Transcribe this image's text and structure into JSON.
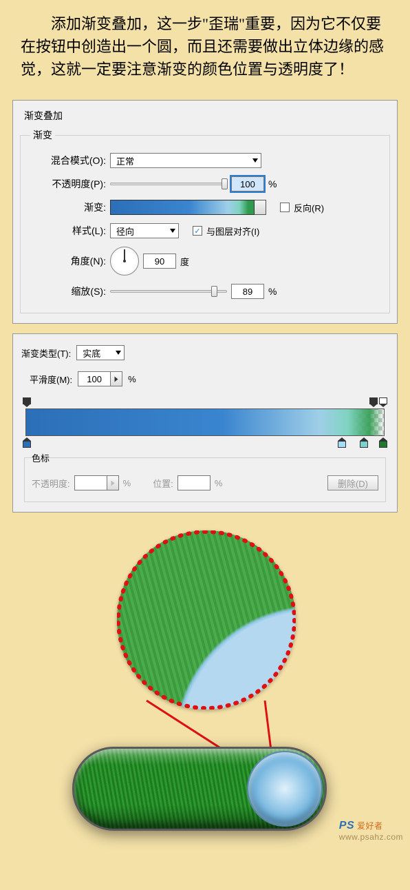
{
  "intro": "　　添加渐变叠加，这一步\"歪瑞\"重要，因为它不仅要在按钮中创造出一个圆，而且还需要做出立体边缘的感觉，这就一定要注意渐变的颜色位置与透明度了！",
  "panel1": {
    "title": "渐变叠加",
    "legend": "渐变",
    "blend_label": "混合模式(O):",
    "blend_value": "正常",
    "opacity_label": "不透明度(P):",
    "opacity_value": "100",
    "pct": "%",
    "gradient_label": "渐变:",
    "reverse_label": "反向(R)",
    "reverse_checked": false,
    "style_label": "样式(L):",
    "style_value": "径向",
    "align_label": "与图层对齐(I)",
    "align_checked": true,
    "angle_label": "角度(N):",
    "angle_value": "90",
    "angle_unit": "度",
    "scale_label": "缩放(S):",
    "scale_value": "89"
  },
  "panel2": {
    "type_label": "渐变类型(T):",
    "type_value": "实底",
    "smooth_label": "平滑度(M):",
    "smooth_value": "100",
    "pct": "%",
    "stops_legend": "色标",
    "opstop_label": "不透明度:",
    "pos_label": "位置:",
    "delete_label": "删除(D)",
    "opacity_stops": [
      {
        "pos": 0,
        "color": "#333"
      },
      {
        "pos": 96,
        "color": "#333"
      },
      {
        "pos": 100,
        "color": "#fff"
      }
    ],
    "color_stops": [
      {
        "pos": 0,
        "color": "#2b6fb8"
      },
      {
        "pos": 85,
        "color": "#a6dcf5"
      },
      {
        "pos": 93,
        "color": "#7bd0d0"
      },
      {
        "pos": 100,
        "color": "#1e7a2e"
      }
    ]
  },
  "watermark": {
    "logo": "PS",
    "cn": "爱好者",
    "url": "www.psahz.com"
  }
}
